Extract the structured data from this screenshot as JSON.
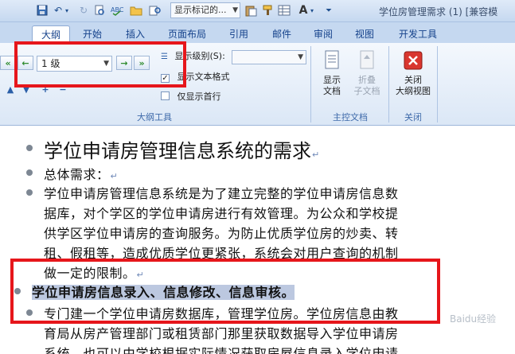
{
  "title_bar": {
    "style_dropdown": "显示标记的...",
    "window_title": "学位房管理需求 (1) [兼容模"
  },
  "tabs": [
    {
      "label": "大纲"
    },
    {
      "label": "开始"
    },
    {
      "label": "插入"
    },
    {
      "label": "页面布局"
    },
    {
      "label": "引用"
    },
    {
      "label": "邮件"
    },
    {
      "label": "审阅"
    },
    {
      "label": "视图"
    },
    {
      "label": "开发工具"
    }
  ],
  "outline_tools": {
    "level_value": "1 级",
    "show_level_label": "显示级别(S):",
    "show_text_format_label": "显示文本格式",
    "show_text_format_checked": true,
    "show_first_line_label": "仅显示首行",
    "show_first_line_checked": false,
    "group_label": "大纲工具"
  },
  "master_document": {
    "show_document_label": [
      "显示",
      "文档"
    ],
    "collapse_subdocuments_label": [
      "折叠",
      "子文档"
    ],
    "group_label": "主控文档"
  },
  "close_group": {
    "close_outline_label": [
      "关闭",
      "大纲视图"
    ],
    "group_label": "关闭"
  },
  "document": {
    "paragraphs": [
      {
        "text": "学位申请房管理信息系统的需求",
        "style": "heading1"
      },
      {
        "text": "总体需求：",
        "style": "body"
      },
      {
        "lines": [
          "学位申请房管理信息系统是为了建立完整的学位申请房信息数",
          "据库，对个学区的学位申请房进行有效管理。为公众和学校提",
          "供学区学位申请房的查询服务。为防止优质学位房的炒卖、转",
          "租、假租等，造成优质学位更紧张，系统会对用户查询的机制",
          "做一定的限制。"
        ],
        "style": "body"
      },
      {
        "text": "学位申请房信息录入、信息修改、信息审核。",
        "style": "highlighted"
      },
      {
        "lines": [
          "专门建一个学位申请房数据库，管理学位房。学位房信息由教",
          "育局从房产管理部门或租赁部门那里获取数据导入学位申请房",
          "系统，也可以由学校根据实际情况获取房屋信息录入学位申请"
        ],
        "style": "body"
      }
    ],
    "paragraph_mark": "↵"
  },
  "watermark": "Baidu经验",
  "colors": {
    "highlight_box": "#e6161b",
    "selection": "#bcc8e0",
    "ribbon_text": "#15428b"
  }
}
